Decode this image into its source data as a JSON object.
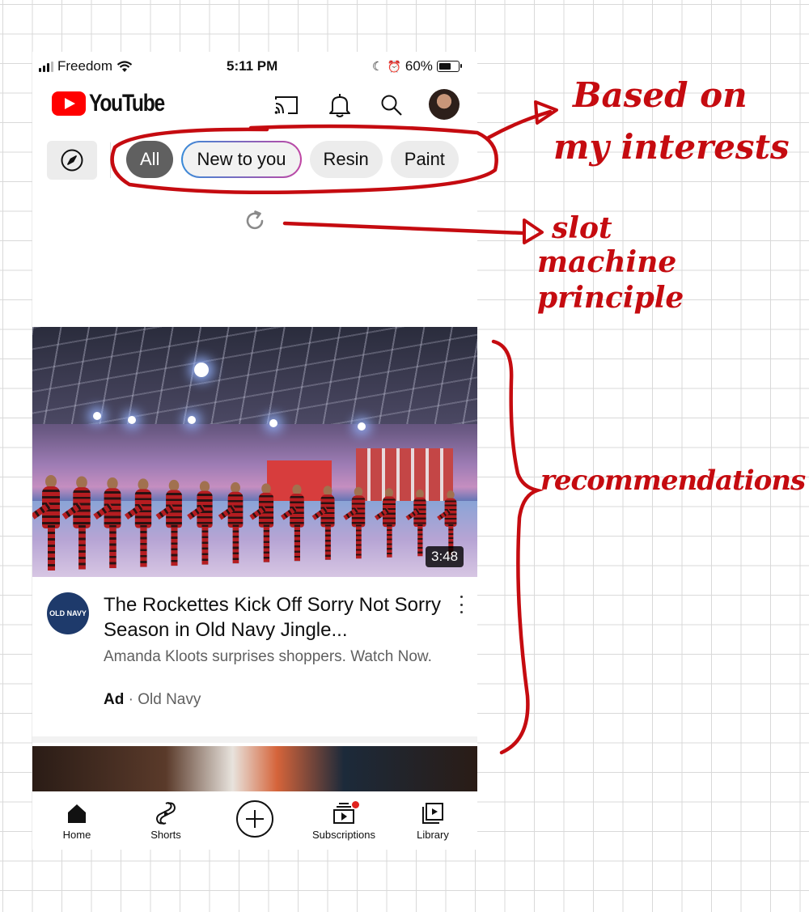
{
  "status_bar": {
    "carrier": "Freedom",
    "time": "5:11 PM",
    "battery": "60%"
  },
  "header": {
    "logo_text": "YouTube",
    "icons": [
      "cast-icon",
      "bell-icon",
      "search-icon",
      "avatar"
    ]
  },
  "chips": [
    {
      "label": "All",
      "active": true
    },
    {
      "label": "New to you",
      "active": false
    },
    {
      "label": "Resin",
      "active": false
    },
    {
      "label": "Paint",
      "active": false
    }
  ],
  "video": {
    "duration": "3:48",
    "channel_avatar_text": "OLD NAVY",
    "title": "The Rockettes Kick Off Sorry Not Sorry Season in Old Navy Jingle...",
    "description": "Amanda Kloots surprises shoppers. Watch Now.",
    "ad_label": "Ad",
    "separator": "·",
    "advertiser": "Old Navy"
  },
  "bottom_nav": [
    {
      "label": "Home",
      "icon": "home-icon"
    },
    {
      "label": "Shorts",
      "icon": "shorts-icon"
    },
    {
      "label": "",
      "icon": "create-icon"
    },
    {
      "label": "Subscriptions",
      "icon": "subscriptions-icon"
    },
    {
      "label": "Library",
      "icon": "library-icon"
    }
  ],
  "annotations": {
    "interests_line1": "Based on",
    "interests_line2": "my interests",
    "slot_line1": "slot",
    "slot_line2": "machine",
    "slot_line3": "principle",
    "recommendations": "recommendations"
  },
  "colors": {
    "youtube_red": "#ff0000",
    "annotation_red": "#c50b10",
    "active_chip": "#606060"
  }
}
